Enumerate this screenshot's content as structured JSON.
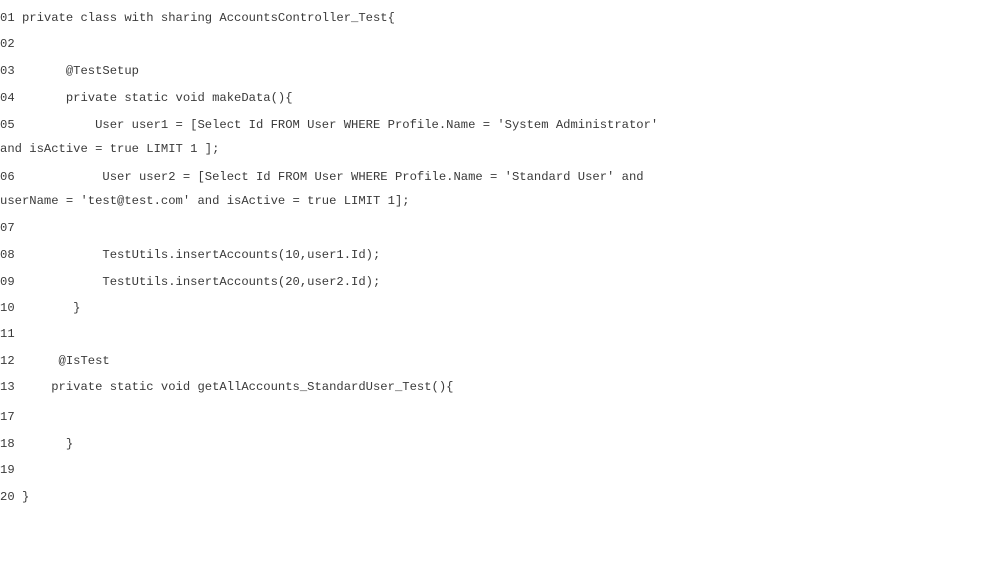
{
  "code_lines": [
    "01 private class with sharing AccountsController_Test{",
    "02",
    "03       @TestSetup",
    "04       private static void makeData(){",
    "05           User user1 = [Select Id FROM User WHERE Profile.Name = 'System Administrator'",
    "and isActive = true LIMIT 1 ];",
    "06            User user2 = [Select Id FROM User WHERE Profile.Name = 'Standard User' and",
    "userName = 'test@test.com' and isActive = true LIMIT 1];",
    "07",
    "08            TestUtils.insertAccounts(10,user1.Id);",
    "09            TestUtils.insertAccounts(20,user2.Id);",
    "10        }",
    "11",
    "12      @IsTest",
    "13     private static void getAllAccounts_StandardUser_Test(){",
    "17",
    "18       }",
    "19",
    "20 }"
  ]
}
